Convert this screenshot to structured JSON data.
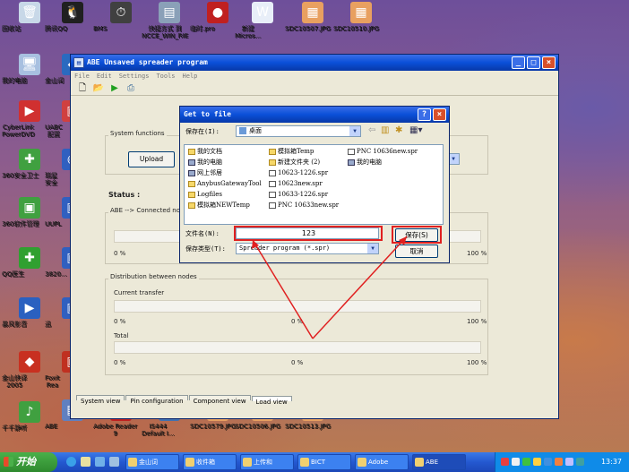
{
  "desktop": {
    "icons": [
      {
        "label": "回收站",
        "glyph": "🗑",
        "color": "#c8d8e8"
      },
      {
        "label": "腾讯QQ",
        "glyph": "🐧",
        "color": "#202020"
      },
      {
        "label": "BMS",
        "glyph": "⏱",
        "color": "#404040"
      },
      {
        "label": "快捷方式 到\nNCCE_WIN_RIE",
        "glyph": "▤",
        "color": "#8aa0b8"
      },
      {
        "label": "临时.pro",
        "glyph": "●",
        "color": "#c02020"
      },
      {
        "label": "新建\nMicros...",
        "glyph": "W",
        "color": "#e8eef8"
      },
      {
        "label": "SDC10507.JPG",
        "glyph": "▦",
        "color": "#e8a060"
      },
      {
        "label": "SDC10510.JPG",
        "glyph": "▦",
        "color": "#e8a060"
      },
      {
        "label": "我的电脑",
        "glyph": "🖥",
        "color": "#a8c0e0"
      },
      {
        "label": "金山词",
        "glyph": "◆",
        "color": "#2a6ac0"
      },
      {
        "label": "CyberLink\nPowerDVD",
        "glyph": "▶",
        "color": "#d03030"
      },
      {
        "label": "UABC\n配置",
        "glyph": "▣",
        "color": "#d04040"
      },
      {
        "label": "360安全卫士",
        "glyph": "✚",
        "color": "#40a040"
      },
      {
        "label": "瑞星\n安全",
        "glyph": "◉",
        "color": "#3060c0"
      },
      {
        "label": "360软件管理",
        "glyph": "▣",
        "color": "#40a040"
      },
      {
        "label": "UUPL",
        "glyph": "▣",
        "color": "#3060c0"
      },
      {
        "label": "QQ医生",
        "glyph": "✚",
        "color": "#30a030"
      },
      {
        "label": "3820...",
        "glyph": "▣",
        "color": "#3060c0"
      },
      {
        "label": "暴风影音",
        "glyph": "▶",
        "color": "#2a60c0"
      },
      {
        "label": "迅",
        "glyph": "▣",
        "color": "#3060c0"
      },
      {
        "label": "金山快译\n2005",
        "glyph": "◆",
        "color": "#c83020"
      },
      {
        "label": "Foxit\nRea",
        "glyph": "▣",
        "color": "#c03020"
      },
      {
        "label": "千千静听",
        "glyph": "♪",
        "color": "#40a040"
      },
      {
        "label": "ABE",
        "glyph": "▤",
        "color": "#6080c0"
      },
      {
        "label": "Adobe Reader\n9",
        "glyph": "◣",
        "color": "#c02020"
      },
      {
        "label": "IS444\nDefault I...",
        "glyph": "▣",
        "color": "#4070b0"
      },
      {
        "label": "SDC10579.JPG",
        "glyph": "▦",
        "color": "#e8a060"
      },
      {
        "label": "SDC10506.JPG",
        "glyph": "▦",
        "color": "#e8a060"
      },
      {
        "label": "SDC10513.JPG",
        "glyph": "▦",
        "color": "#e8a060"
      }
    ]
  },
  "window": {
    "title": "ABE Unsaved spreader program",
    "menu": [
      "File",
      "Edit",
      "Settings",
      "Tools",
      "Help"
    ],
    "toolbar_icons": [
      "new-icon",
      "open-icon",
      "run-icon",
      "print-icon"
    ],
    "system_functions_label": "System functions",
    "upload_label": "Upload",
    "status_label": "Status :",
    "abe_connected_label": "ABE --> Connected nod",
    "pct_0": "0 %",
    "pct_100": "100 %",
    "distribution_label": "Distribution between nodes",
    "current_transfer_label": "Current transfer",
    "total_label": "Total",
    "tabs": [
      "System view",
      "Pin configuration",
      "Component view",
      "Load view"
    ],
    "active_tab": "Load view"
  },
  "dialog": {
    "title": "Get to file",
    "save_in_label": "保存在(I):",
    "save_in_value": "桌面",
    "files": [
      {
        "name": "我的文档",
        "type": "folder"
      },
      {
        "name": "我的电脑",
        "type": "pc"
      },
      {
        "name": "网上邻居",
        "type": "pc"
      },
      {
        "name": "AnybusGatewayTool",
        "type": "folder"
      },
      {
        "name": "Logfiles",
        "type": "folder"
      },
      {
        "name": "模拟箱NEWTemp",
        "type": "folder"
      },
      {
        "name": "模拟箱Temp",
        "type": "folder"
      },
      {
        "name": "新建文件夹 (2)",
        "type": "folder"
      },
      {
        "name": "10623-1226.spr",
        "type": "doc"
      },
      {
        "name": "10623new.spr",
        "type": "doc"
      },
      {
        "name": "10633-1226.spr",
        "type": "doc"
      },
      {
        "name": "PNC 10633new.spr",
        "type": "doc"
      },
      {
        "name": "PNC 10636new.spr",
        "type": "doc"
      },
      {
        "name": "我的电脑",
        "type": "pc"
      }
    ],
    "filename_label": "文件名(N):",
    "filename_value": "123",
    "filetype_label": "保存类型(T):",
    "filetype_value": "Spreader program (*.spr)",
    "save_label": "保存(S)",
    "cancel_label": "取消",
    "highlight_color": "#e02020"
  },
  "taskbar": {
    "start_label": "开始",
    "tasks": [
      "金山词",
      "收件箱",
      "上传和",
      "BICT",
      "Adobe",
      "ABE"
    ],
    "active_task": "ABE",
    "clock": "13:37"
  }
}
